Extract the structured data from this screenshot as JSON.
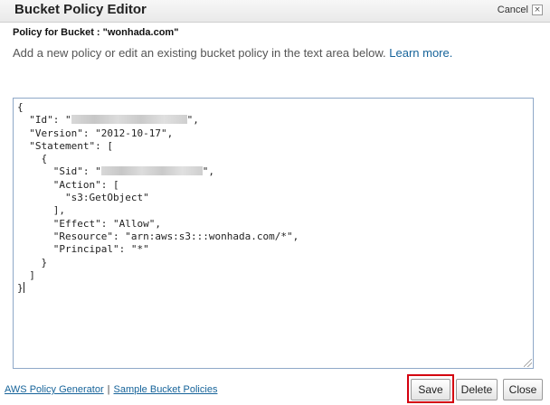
{
  "dialog": {
    "title": "Bucket Policy Editor",
    "cancel_label": "Cancel",
    "close_glyph": "×"
  },
  "subheader": "Policy for Bucket : \"wonhada.com\"",
  "description": {
    "text": "Add a new policy or edit an existing bucket policy in the text area below.",
    "learn_more": "Learn more."
  },
  "policy": {
    "line1": "{",
    "id_prefix": "  \"Id\": \"",
    "id_suffix": "\",",
    "version_line": "  \"Version\": \"2012-10-17\",",
    "statement_line": "  \"Statement\": [",
    "open_obj": "    {",
    "sid_prefix": "      \"Sid\": \"",
    "sid_suffix": "\",",
    "action_line": "      \"Action\": [",
    "action_value": "        \"s3:GetObject\"",
    "action_close": "      ],",
    "effect_line": "      \"Effect\": \"Allow\",",
    "resource_line": "      \"Resource\": \"arn:aws:s3:::wonhada.com/*\",",
    "principal_line": "      \"Principal\": \"*\"",
    "close_obj": "    }",
    "close_arr": "  ]",
    "close_root": "}"
  },
  "footer": {
    "generator_link": "AWS Policy Generator",
    "separator": "|",
    "sample_link": "Sample Bucket Policies",
    "save_label": "Save",
    "delete_label": "Delete",
    "close_label": "Close"
  },
  "colors": {
    "link": "#17649a",
    "highlight_outline": "#d4000f"
  }
}
